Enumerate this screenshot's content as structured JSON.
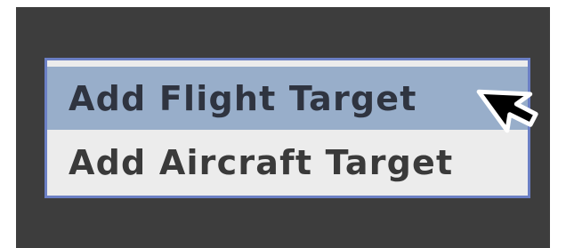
{
  "context_menu": {
    "items": [
      {
        "label": "Add Flight Target",
        "highlighted": true
      },
      {
        "label": "Add Aircraft Target",
        "highlighted": false
      }
    ]
  },
  "colors": {
    "background": "#3d3d3d",
    "menu_border": "#6b7fc4",
    "highlight": "#98aeca",
    "menu_bg": "#ececec"
  },
  "icons": {
    "pointer": "mouse-pointer-icon"
  }
}
